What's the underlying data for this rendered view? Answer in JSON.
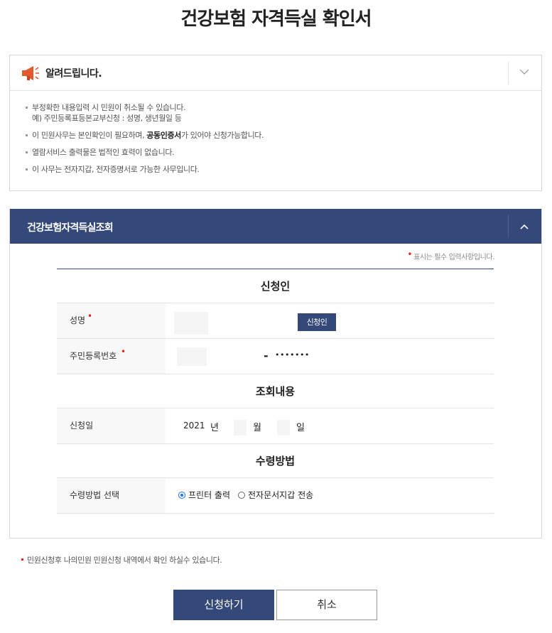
{
  "page": {
    "title": "건강보험 자격득실 확인서"
  },
  "notice": {
    "title": "알려드립니다.",
    "items": [
      "부정확한 내용입력 시 민원이 취소될 수 있습니다.",
      "예) 주민등록표등본교부신청 : 성명, 생년월일 등",
      "이 민원사무는 본인확인이 필요하며, ",
      "공동인증서",
      "가 있어야 신청가능합니다.",
      "열람서비스 출력물은 법적인 효력이 없습니다.",
      "이 사무는 전자지갑, 전자증명서로 가능한 사무입니다."
    ]
  },
  "panel": {
    "title": "건강보험자격득실조회",
    "required_note": "표시는 필수 입력사항입니다.",
    "applicant_section": "신청인",
    "name_label": "성명",
    "applicant_button": "신청인",
    "rrn_label": "주민등록번호",
    "rrn_dash": "-",
    "rrn_masked": "•••••••",
    "query_section": "조회내용",
    "date_label": "신청일",
    "year": "2021",
    "year_unit": "년",
    "month_unit": "월",
    "day_unit": "일",
    "receive_section": "수령방법",
    "receive_label": "수령방법 선택",
    "options": [
      "프린터 출력",
      "전자문서지갑 전송"
    ],
    "selected_option": "프린터 출력"
  },
  "footer": {
    "note": "민원신청후 나의민원 민원신청 내역에서 확인 하실수 있습니다.",
    "submit_label": "신청하기",
    "cancel_label": "취소"
  },
  "colors": {
    "primary": "#34497a",
    "required": "#e2231a",
    "radio": "#1a73e8"
  }
}
